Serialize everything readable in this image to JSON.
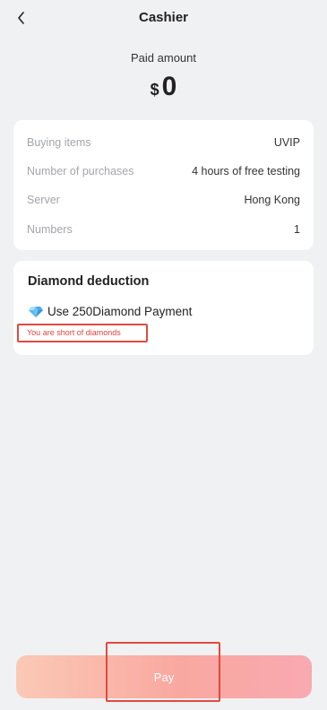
{
  "header": {
    "title": "Cashier"
  },
  "payment": {
    "paid_label": "Paid amount",
    "currency": "$",
    "amount": "0"
  },
  "details": {
    "rows": [
      {
        "label": "Buying items",
        "value": "UVIP"
      },
      {
        "label": "Number of purchases",
        "value": "4 hours of free testing"
      },
      {
        "label": "Server",
        "value": "Hong Kong"
      },
      {
        "label": "Numbers",
        "value": "1"
      }
    ]
  },
  "diamond": {
    "title": "Diamond deduction",
    "option_label": "Use 250Diamond Payment",
    "warning": "You are short of diamonds"
  },
  "footer": {
    "pay_label": "Pay"
  },
  "icons": {
    "back": "chevron-left-icon",
    "diamond": "diamond-icon"
  },
  "colors": {
    "background": "#f0f1f3",
    "card": "#ffffff",
    "warning": "#e0433a",
    "pay_gradient_start": "#fbc9b6",
    "pay_gradient_end": "#f9a8a0"
  }
}
